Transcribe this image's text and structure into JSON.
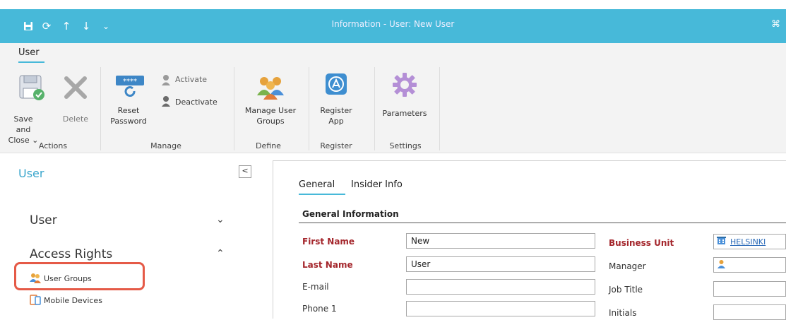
{
  "window": {
    "title": "Information - User: New User"
  },
  "quick_access": [
    {
      "name": "save-icon",
      "glyph": "💾"
    },
    {
      "name": "refresh-icon",
      "glyph": "⟳"
    },
    {
      "name": "arrow-up-icon",
      "glyph": "↑"
    },
    {
      "name": "arrow-down-icon",
      "glyph": "↓"
    },
    {
      "name": "dropdown-icon",
      "glyph": "⌄"
    }
  ],
  "ribbon": {
    "tab": "User",
    "buttons": {
      "save_close": "Save and Close ⌄",
      "delete": "Delete",
      "reset_password": "Reset Password",
      "activate": "Activate",
      "deactivate": "Deactivate",
      "manage_user_groups": "Manage User Groups",
      "register_app": "Register App",
      "parameters": "Parameters"
    },
    "groups": {
      "actions": "Actions",
      "manage": "Manage",
      "define": "Define",
      "register": "Register",
      "settings": "Settings"
    }
  },
  "nav": {
    "title": "User",
    "collapse_glyph": "<",
    "sections": [
      {
        "label": "User",
        "chevron": "⌄"
      },
      {
        "label": "Access Rights",
        "chevron": "⌃"
      }
    ],
    "items": [
      {
        "label": "User Groups"
      },
      {
        "label": "Mobile Devices"
      }
    ]
  },
  "main": {
    "tabs": [
      "General",
      "Insider Info"
    ],
    "section_title": "General Information",
    "fields": {
      "first_name": {
        "label": "First Name",
        "value": "New"
      },
      "last_name": {
        "label": "Last Name",
        "value": "User"
      },
      "email": {
        "label": "E-mail",
        "value": ""
      },
      "phone1": {
        "label": "Phone 1",
        "value": ""
      },
      "business_unit": {
        "label": "Business Unit",
        "value": "HELSINKI"
      },
      "manager": {
        "label": "Manager",
        "value": ""
      },
      "job_title": {
        "label": "Job Title",
        "value": ""
      },
      "initials": {
        "label": "Initials",
        "value": ""
      }
    }
  },
  "colors": {
    "accent": "#47b9d9",
    "required_label": "#a4262c",
    "highlight": "#e55a47",
    "link": "#2a6ab8"
  }
}
